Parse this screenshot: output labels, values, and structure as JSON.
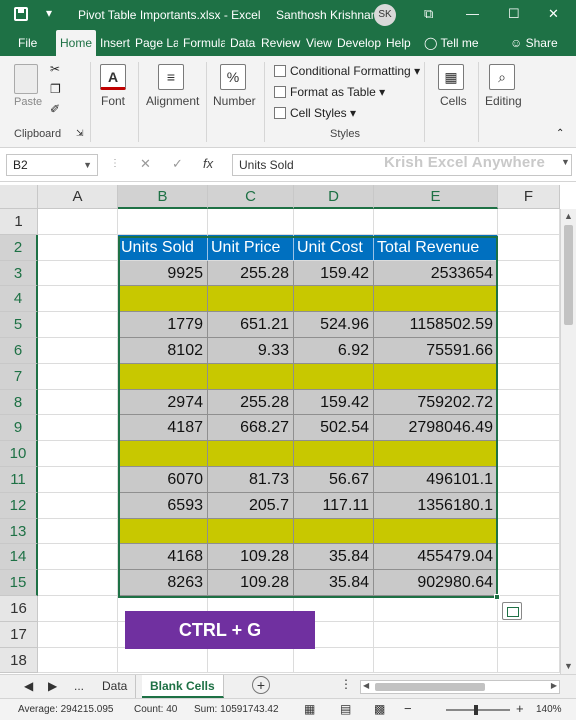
{
  "titlebar": {
    "file_title": "Pivot Table Importants.xlsx  -  Excel",
    "user_name": "Santhosh Krishnan",
    "user_initials": "SK",
    "qat_dropdown": "▾",
    "icon_present": "⧉",
    "icon_minimize": "—",
    "icon_maximize": "☐",
    "icon_close": "✕"
  },
  "tabs": [
    "File",
    "Home",
    "Insert",
    "Page Layout",
    "Formulas",
    "Data",
    "Review",
    "View",
    "Developer",
    "Help"
  ],
  "tell_me": "Tell me",
  "share": "Share",
  "ribbon": {
    "paste": "Paste",
    "clipboard": "Clipboard",
    "font": "Font",
    "alignment": "Alignment",
    "number": "Number",
    "number_icon": "%",
    "conditional_formatting": "Conditional Formatting",
    "format_as_table": "Format as Table",
    "cell_styles": "Cell Styles",
    "styles": "Styles",
    "cells": "Cells",
    "editing": "Editing",
    "font_icon": "A",
    "editing_icon": "⌕"
  },
  "formula_bar": {
    "name_box": "B2",
    "cancel": "✕",
    "enter": "✓",
    "fx": "fx",
    "content": "Units Sold",
    "watermark": "Krish Excel Anywhere"
  },
  "columns": [
    "A",
    "B",
    "C",
    "D",
    "E",
    "F"
  ],
  "rows": [
    "1",
    "2",
    "3",
    "4",
    "5",
    "6",
    "7",
    "8",
    "9",
    "10",
    "11",
    "12",
    "13",
    "14",
    "15",
    "16",
    "17",
    "18"
  ],
  "table": {
    "headers": [
      "Units Sold",
      "Unit Price",
      "Unit Cost",
      "Total Revenue"
    ],
    "rows": [
      [
        "9925",
        "255.28",
        "159.42",
        "2533654"
      ],
      [
        "",
        "",
        "",
        ""
      ],
      [
        "1779",
        "651.21",
        "524.96",
        "1158502.59"
      ],
      [
        "8102",
        "9.33",
        "6.92",
        "75591.66"
      ],
      [
        "",
        "",
        "",
        ""
      ],
      [
        "2974",
        "255.28",
        "159.42",
        "759202.72"
      ],
      [
        "4187",
        "668.27",
        "502.54",
        "2798046.49"
      ],
      [
        "",
        "",
        "",
        ""
      ],
      [
        "6070",
        "81.73",
        "56.67",
        "496101.1"
      ],
      [
        "6593",
        "205.7",
        "117.11",
        "1356180.1"
      ],
      [
        "",
        "",
        "",
        ""
      ],
      [
        "4168",
        "109.28",
        "35.84",
        "455479.04"
      ],
      [
        "8263",
        "109.28",
        "35.84",
        "902980.64"
      ]
    ]
  },
  "overlay_label": "CTRL + G",
  "sheets": {
    "more": "...",
    "tabs": [
      "Data",
      "Blank Cells"
    ],
    "add": "+"
  },
  "status": {
    "average": "Average: 294215.095",
    "count": "Count: 40",
    "sum": "Sum: 10591743.42",
    "zoom": "140%",
    "zoom_minus": "−",
    "zoom_plus": "+"
  }
}
